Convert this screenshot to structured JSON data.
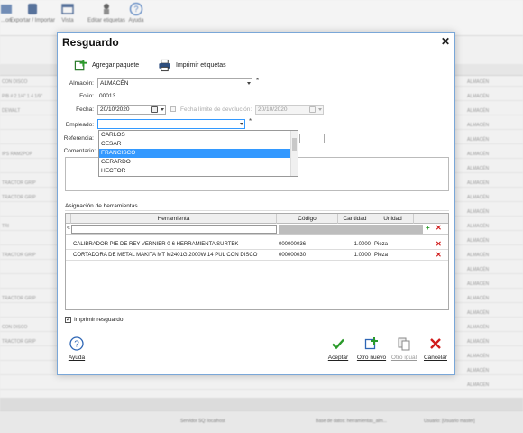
{
  "app": {
    "ribbon": [
      {
        "label": "...on"
      },
      {
        "label": "Exportar / Importar"
      },
      {
        "label": "Vista"
      },
      {
        "label": "Editar etiquetas"
      },
      {
        "label": "Ayuda"
      }
    ],
    "bg_rows": [
      {
        "a": "CON DISCO",
        "b": "ALMACÉN"
      },
      {
        "a": "P/B # 2 1/4\" 1 4 1/9\"",
        "b": "ALMACÉN"
      },
      {
        "a": "DEWALT",
        "b": "ALMACÉN"
      },
      {
        "a": "",
        "b": "ALMACÉN"
      },
      {
        "a": "",
        "b": "ALMACÉN"
      },
      {
        "a": "IPS RAM2POP",
        "b": "ALMACÉN"
      },
      {
        "a": "",
        "b": "ALMACÉN"
      },
      {
        "a": "TRACTOR GRIP",
        "b": "ALMACÉN"
      },
      {
        "a": "TRACTOR GRIP",
        "b": "ALMACÉN"
      },
      {
        "a": "",
        "b": "ALMACÉN"
      },
      {
        "a": "TRI",
        "b": "ALMACÉN"
      },
      {
        "a": "",
        "b": "ALMACÉN"
      },
      {
        "a": "TRACTOR GRIP",
        "b": "ALMACÉN"
      },
      {
        "a": "",
        "b": "ALMACÉN"
      },
      {
        "a": "",
        "b": "ALMACÉN"
      },
      {
        "a": "TRACTOR GRIP",
        "b": "ALMACÉN"
      },
      {
        "a": "",
        "b": "ALMACÉN"
      },
      {
        "a": "CON DISCO",
        "b": "ALMACÉN"
      },
      {
        "a": "TRACTOR GRIP",
        "b": "ALMACÉN"
      },
      {
        "a": "",
        "b": "ALMACÉN"
      },
      {
        "a": "",
        "b": "ALMACÉN"
      },
      {
        "a": "",
        "b": "ALMACÉN"
      }
    ],
    "status_items": [
      "Servidor SQ: localhost",
      "Base de datos: herramientas_alm...",
      "Usuario: [Usuario master]"
    ]
  },
  "dialog": {
    "title": "Resguardo",
    "close": "✕",
    "toolbar": {
      "add_package": "Agregar paquete",
      "print_labels": "Imprimir etiquetas"
    },
    "form": {
      "almacen_label": "Almacén:",
      "almacen_value": "ALMACÉN",
      "folio_label": "Folio:",
      "folio_value": "00013",
      "fecha_label": "Fecha:",
      "fecha_value": "20/10/2020",
      "fecha_dev_label": "Fecha límite de devolución:",
      "fecha_dev_value": "20/10/2020",
      "empleado_label": "Empleado:",
      "empleado_value": "",
      "referencia_label": "Referencia:",
      "comentario_label": "Comentario:",
      "required_mark": "*"
    },
    "employee_options": [
      "CARLOS",
      "CESAR",
      "FRANCISCO",
      "GERARDO",
      "HECTOR"
    ],
    "employee_selected_index": 2,
    "grid": {
      "section_label": "Asignación de herramientas",
      "columns": [
        "Herramienta",
        "Código",
        "Cantidad",
        "Unidad"
      ],
      "filter_indicator": "«",
      "rows": [
        {
          "tool": "CALIBRADOR PIE DE REY VERNIER 0-6 HERRAMIENTA SURTEK",
          "code": "000000036",
          "qty": "1.0000",
          "unit": "Pieza"
        },
        {
          "tool": "CORTADORA DE METAL MAKITA MT M2401G 2000W 14 PUL CON DISCO",
          "code": "000000030",
          "qty": "1.0000",
          "unit": "Pieza"
        }
      ]
    },
    "print_checkbox": {
      "label": "Imprimir resguardo",
      "checked": true
    },
    "footer": {
      "help": "Ayuda",
      "accept": "Aceptar",
      "new_other": "Otro nuevo",
      "same_other": "Otro igual",
      "cancel": "Cancelar"
    }
  },
  "colors": {
    "accent_blue": "#3399ff",
    "delete_red": "#d01c1c",
    "add_green": "#2a9a2a"
  }
}
